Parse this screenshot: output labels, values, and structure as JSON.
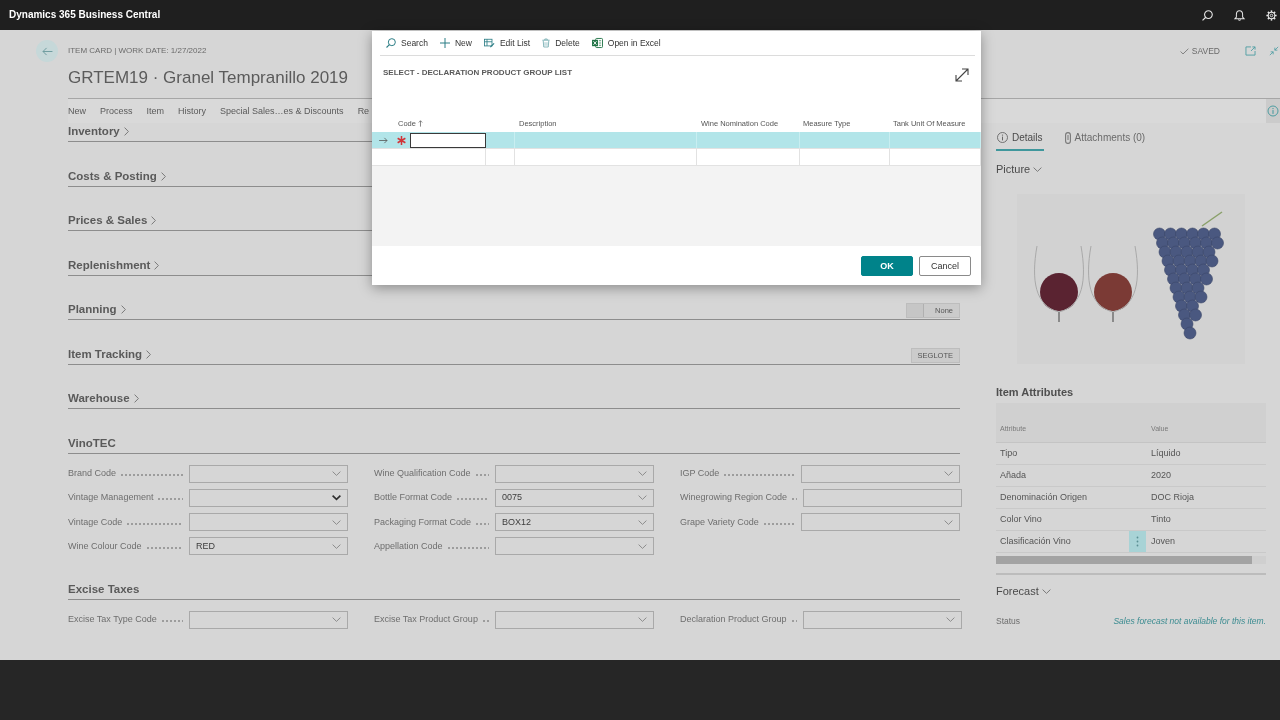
{
  "app": {
    "title": "Dynamics 365 Business Central"
  },
  "card": {
    "breadcrumb": "ITEM CARD | WORK DATE: 1/27/2022",
    "title": "GRTEM19 · Granel Tempranillo 2019",
    "save_status": "SAVED",
    "actions": [
      "New",
      "Process",
      "Item",
      "History",
      "Special Sales…es & Discounts",
      "Re"
    ],
    "sections": [
      {
        "title": "Inventory",
        "expanded": false
      },
      {
        "title": "Costs & Posting",
        "expanded": false
      },
      {
        "title": "Prices & Sales",
        "expanded": false
      },
      {
        "title": "Replenishment",
        "expanded": false
      },
      {
        "title": "Planning",
        "expanded": false,
        "summary": {
          "value": "None",
          "leading_blank": true
        }
      },
      {
        "title": "Item Tracking",
        "expanded": false,
        "summary": {
          "value": "SEGLOTE",
          "leading_blank": false
        }
      },
      {
        "title": "Warehouse",
        "expanded": false
      },
      {
        "title": "VinoTEC",
        "expanded": true,
        "columns": [
          [
            {
              "label": "Brand Code",
              "kind": "lookup"
            },
            {
              "label": "Vintage Management",
              "kind": "option"
            },
            {
              "label": "Vintage Code",
              "kind": "lookup"
            },
            {
              "label": "Wine Colour Code",
              "kind": "lookup",
              "value": "RED"
            }
          ],
          [
            {
              "label": "Wine Qualification Code",
              "kind": "lookup"
            },
            {
              "label": "Bottle Format Code",
              "kind": "lookup",
              "value": "0075"
            },
            {
              "label": "Packaging Format Code",
              "kind": "lookup",
              "value": "BOX12"
            },
            {
              "label": "Appellation Code",
              "kind": "lookup"
            }
          ],
          [
            {
              "label": "IGP Code",
              "kind": "lookup"
            },
            {
              "label": "Winegrowing Region Code",
              "kind": "text"
            },
            {
              "label": "Grape Variety Code",
              "kind": "lookup"
            }
          ]
        ]
      },
      {
        "title": "Excise Taxes",
        "expanded": true,
        "columns": [
          [
            {
              "label": "Excise Tax Type Code",
              "kind": "lookup"
            }
          ],
          [
            {
              "label": "Excise Tax Product Group",
              "kind": "lookup"
            }
          ],
          [
            {
              "label": "Declaration Product Group",
              "kind": "lookup"
            }
          ]
        ]
      }
    ]
  },
  "factbox": {
    "tabs": [
      {
        "label": "Details",
        "selected": true
      },
      {
        "label": "Attachments (0)",
        "selected": false
      }
    ],
    "picture": {
      "title": "Picture",
      "expanded": true
    },
    "attributes": {
      "title": "Item Attributes",
      "columns": [
        "Attribute",
        "Value"
      ],
      "rows": [
        {
          "attribute": "Tipo",
          "value": "Líquido",
          "selected": false
        },
        {
          "attribute": "Añada",
          "value": "2020",
          "selected": false
        },
        {
          "attribute": "Denominación Origen",
          "value": "DOC Rioja",
          "selected": false
        },
        {
          "attribute": "Color Vino",
          "value": "Tinto",
          "selected": false
        },
        {
          "attribute": "Clasificación Vino",
          "value": "Joven",
          "selected": true
        }
      ]
    },
    "forecast": {
      "title": "Forecast",
      "expanded": true,
      "label": "Status",
      "value": "Sales forecast not available for this item."
    }
  },
  "dialog": {
    "toolbar": [
      "Search",
      "New",
      "Edit List",
      "Delete",
      "Open in Excel"
    ],
    "title": "SELECT - DECLARATION PRODUCT GROUP LIST",
    "columns": [
      {
        "label": "Code",
        "sorted": true
      },
      {
        "label": "Description",
        "sorted": false
      },
      {
        "label": "Wine Nomination Code",
        "sorted": false
      },
      {
        "label": "Measure Type",
        "sorted": false
      },
      {
        "label": "Tank Unit Of Measure",
        "sorted": false
      }
    ],
    "rows": [
      {
        "selected": true,
        "new": true
      },
      {
        "selected": false,
        "new": false
      }
    ],
    "buttons": [
      {
        "label": "OK",
        "kind": "primary"
      },
      {
        "label": "Cancel",
        "kind": "secondary"
      }
    ]
  }
}
